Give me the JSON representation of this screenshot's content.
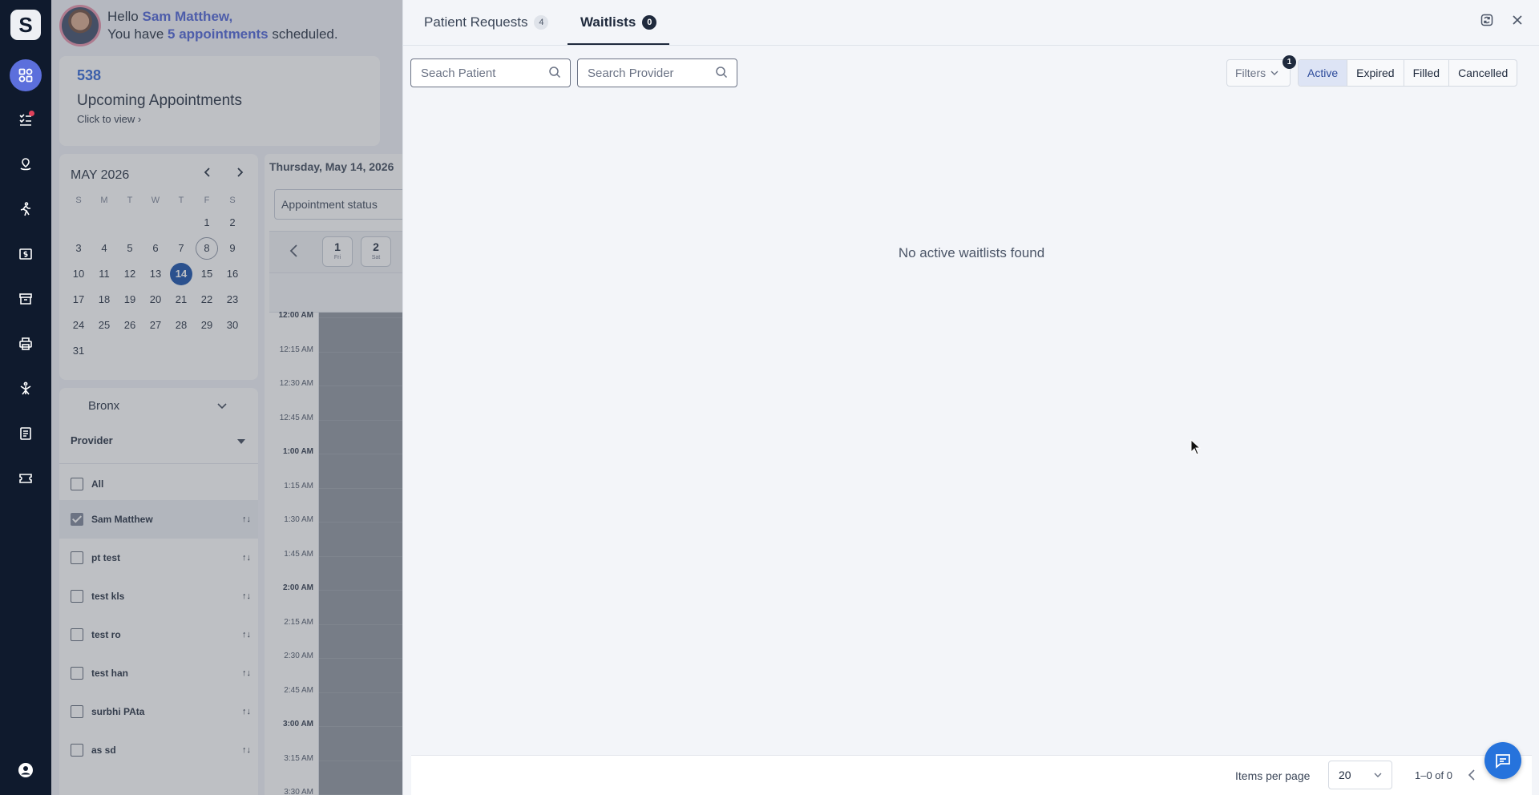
{
  "nav": {
    "logo": "S",
    "icons": [
      "dashboard-icon",
      "tasks-icon",
      "vitals-icon",
      "exercise-icon",
      "billing-icon",
      "archive-icon",
      "printer-icon",
      "therapy-icon",
      "notes-icon",
      "ticket-icon",
      "profile-icon"
    ]
  },
  "greeting": {
    "hello": "Hello",
    "name": "Sam Matthew,",
    "line2_prefix": "You have",
    "count": "5 appointments",
    "line2_suffix": "scheduled."
  },
  "upcoming": {
    "count": "538",
    "title": "Upcoming Appointments",
    "link": "Click to view"
  },
  "calendar": {
    "month": "MAY 2026",
    "dow": [
      "S",
      "M",
      "T",
      "W",
      "T",
      "F",
      "S"
    ],
    "weeks": [
      [
        "",
        "",
        "",
        "",
        "",
        "1",
        "2"
      ],
      [
        "3",
        "4",
        "5",
        "6",
        "7",
        "8",
        "9"
      ],
      [
        "10",
        "11",
        "12",
        "13",
        "14",
        "15",
        "16"
      ],
      [
        "17",
        "18",
        "19",
        "20",
        "21",
        "22",
        "23"
      ],
      [
        "24",
        "25",
        "26",
        "27",
        "28",
        "29",
        "30"
      ],
      [
        "31",
        "",
        "",
        "",
        "",
        "",
        ""
      ]
    ],
    "today": "8",
    "selected": "14"
  },
  "providers": {
    "location": "Bronx",
    "label": "Provider",
    "items": [
      {
        "name": "All",
        "checked": false,
        "sort": false
      },
      {
        "name": "Sam Matthew",
        "checked": true,
        "sort": true
      },
      {
        "name": "pt test",
        "checked": false,
        "sort": true
      },
      {
        "name": "test kls",
        "checked": false,
        "sort": true
      },
      {
        "name": "test ro",
        "checked": false,
        "sort": true
      },
      {
        "name": "test han",
        "checked": false,
        "sort": true
      },
      {
        "name": "surbhi PAta",
        "checked": false,
        "sort": true
      },
      {
        "name": "as sd",
        "checked": false,
        "sort": true
      }
    ]
  },
  "schedule": {
    "date": "Thursday, May 14, 2026",
    "status_label": "Appointment status",
    "days": [
      {
        "n": "1",
        "w": "Fri"
      },
      {
        "n": "2",
        "w": "Sat"
      }
    ],
    "times": [
      {
        "t": "12:00 AM",
        "b": true
      },
      {
        "t": "12:15 AM",
        "b": false
      },
      {
        "t": "12:30 AM",
        "b": false
      },
      {
        "t": "12:45 AM",
        "b": false
      },
      {
        "t": "1:00 AM",
        "b": true
      },
      {
        "t": "1:15 AM",
        "b": false
      },
      {
        "t": "1:30 AM",
        "b": false
      },
      {
        "t": "1:45 AM",
        "b": false
      },
      {
        "t": "2:00 AM",
        "b": true
      },
      {
        "t": "2:15 AM",
        "b": false
      },
      {
        "t": "2:30 AM",
        "b": false
      },
      {
        "t": "2:45 AM",
        "b": false
      },
      {
        "t": "3:00 AM",
        "b": true
      },
      {
        "t": "3:15 AM",
        "b": false
      },
      {
        "t": "3:30 AM",
        "b": false
      }
    ]
  },
  "drawer": {
    "tabs": [
      {
        "label": "Patient Requests",
        "badge": "4"
      },
      {
        "label": "Waitlists",
        "badge": "0"
      }
    ],
    "search_patient_placeholder": "Seach Patient",
    "search_provider_placeholder": "Search Provider",
    "filters_label": "Filters",
    "filters_count": "1",
    "segments": [
      "Active",
      "Expired",
      "Filled",
      "Cancelled"
    ],
    "active_segment": "Active",
    "empty_message": "No active waitlists found",
    "footer": {
      "items_per_page_label": "Items per page",
      "items_per_page": "20",
      "range": "1–0 of 0"
    }
  },
  "colors": {
    "nav_bg": "#0f1a2d",
    "accent": "#4a5fd6",
    "selected_day": "#124da8",
    "fab": "#2673dc"
  }
}
